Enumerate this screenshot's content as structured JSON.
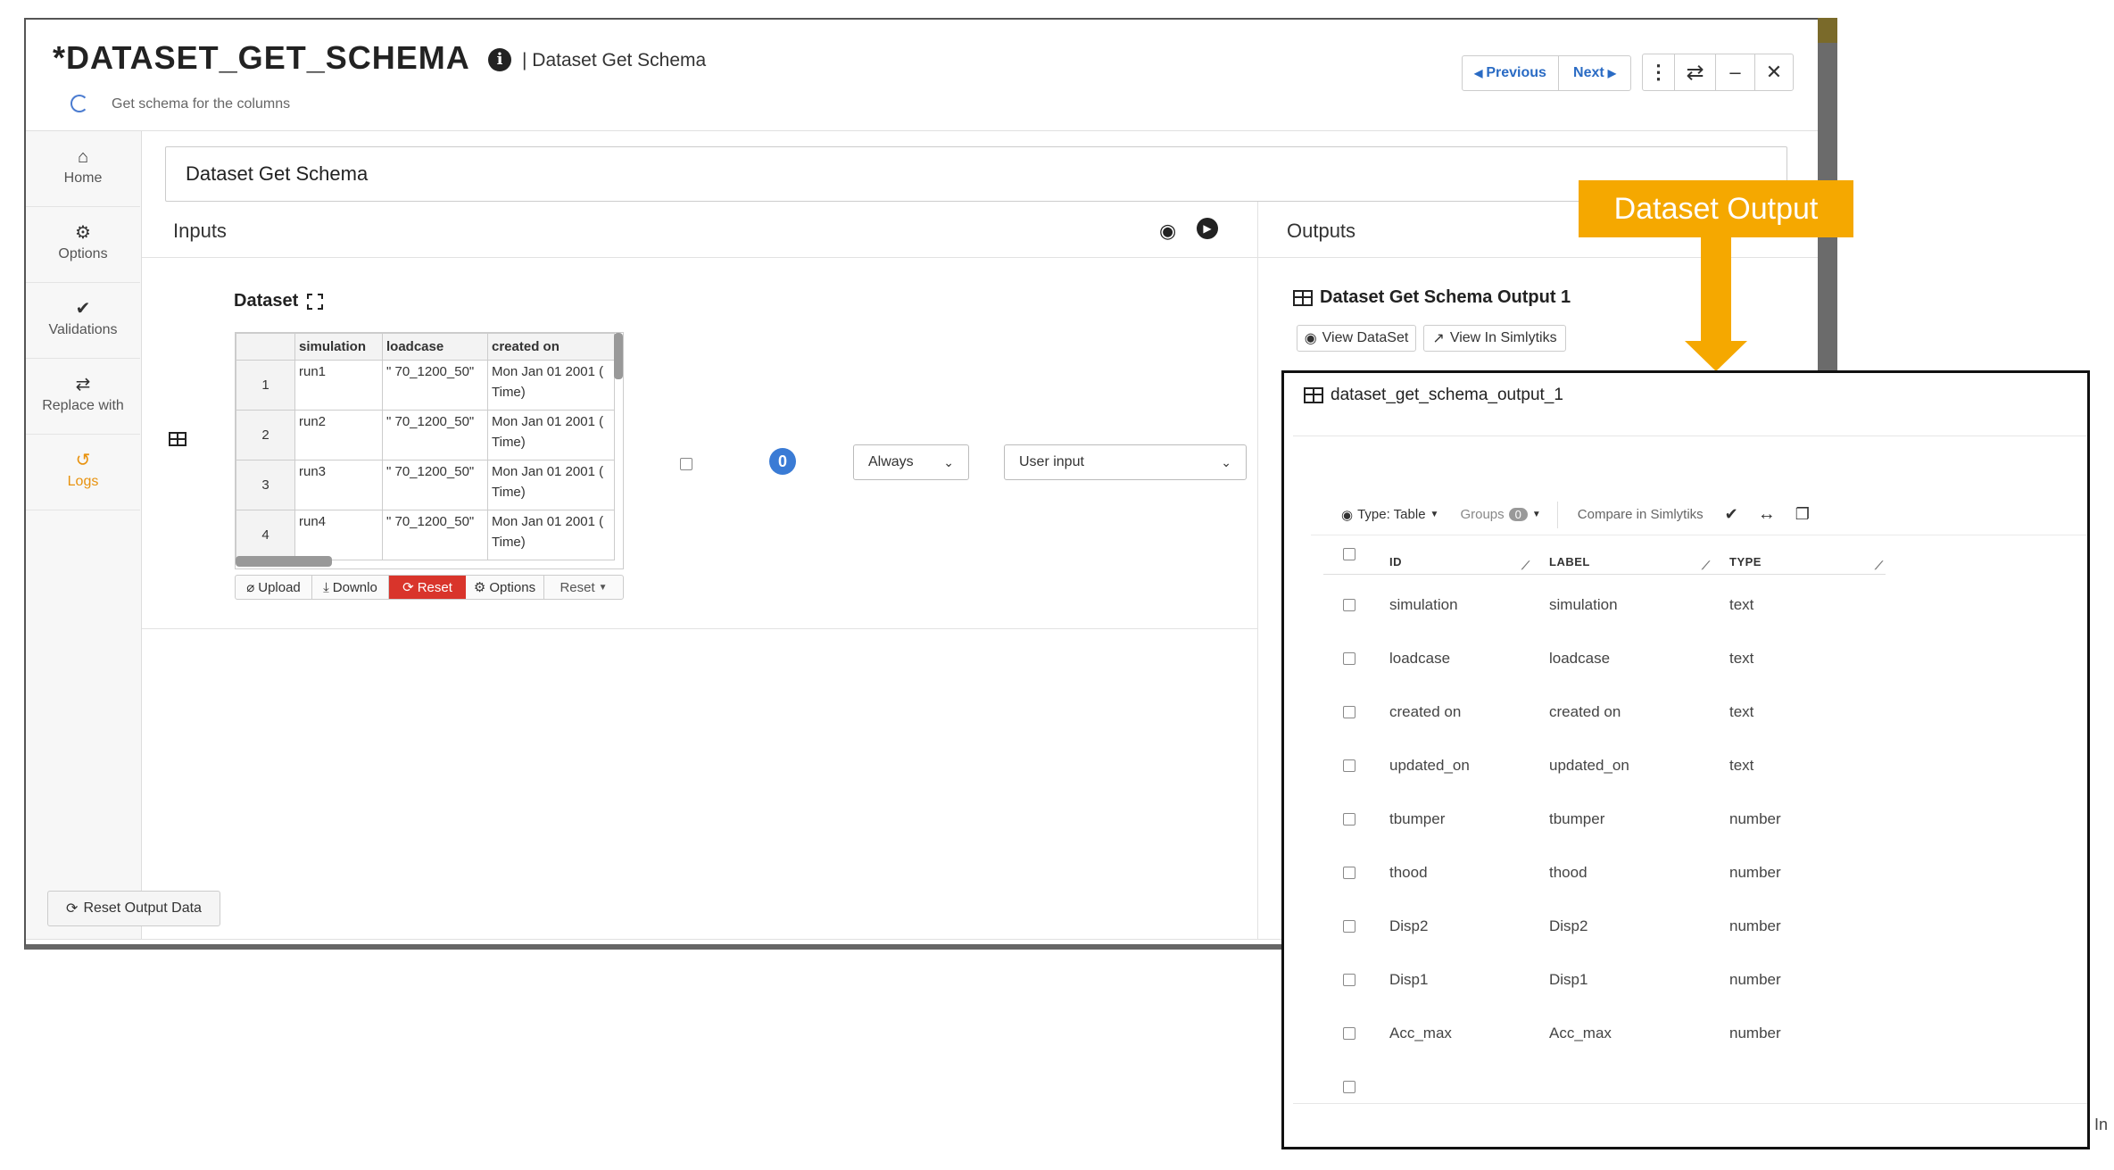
{
  "header": {
    "title": "*DATASET_GET_SCHEMA",
    "subtitle_sep": "| Dataset Get Schema",
    "description": "Get schema for the columns",
    "prev_label": "Previous",
    "next_label": "Next"
  },
  "sidebar": {
    "items": [
      {
        "label": "Home",
        "icon": "home-icon"
      },
      {
        "label": "Options",
        "icon": "gear-icon"
      },
      {
        "label": "Validations",
        "icon": "double-check-icon"
      },
      {
        "label": "Replace with",
        "icon": "swap-icon"
      },
      {
        "label": "Logs",
        "icon": "history-icon"
      }
    ]
  },
  "main": {
    "name_value": "Dataset Get Schema",
    "inputs_title": "Inputs",
    "outputs_title": "Outputs",
    "dataset_label": "Dataset",
    "badge_count": "0",
    "when_select": "Always",
    "source_select": "User input",
    "table": {
      "headers": [
        "simulation",
        "loadcase",
        "created on"
      ],
      "rows": [
        {
          "n": "1",
          "simulation": "run1",
          "loadcase": "\" 70_1200_50\"",
          "created": "Mon Jan 01 2001 (",
          "created2": "Time)"
        },
        {
          "n": "2",
          "simulation": "run2",
          "loadcase": "\" 70_1200_50\"",
          "created": "Mon Jan 01 2001 (",
          "created2": "Time)"
        },
        {
          "n": "3",
          "simulation": "run3",
          "loadcase": "\" 70_1200_50\"",
          "created": "Mon Jan 01 2001 (",
          "created2": "Time)"
        },
        {
          "n": "4",
          "simulation": "run4",
          "loadcase": "\" 70_1200_50\"",
          "created": "Mon Jan 01 2001 (",
          "created2": "Time)"
        }
      ],
      "buttons": {
        "upload": "Upload",
        "download": "Downlo",
        "reset": "Reset",
        "options": "Options",
        "reset_dd": "Reset"
      }
    },
    "output": {
      "title": "Dataset Get Schema Output 1",
      "view_dataset": "View DataSet",
      "view_simlytiks": "View In Simlytiks"
    },
    "reset_output": "Reset Output Data"
  },
  "callout": {
    "label": "Dataset Output",
    "color": "#f5a800"
  },
  "zoom_panel": {
    "title": "dataset_get_schema_output_1",
    "toolbar": {
      "type": "Type: Table",
      "groups": "Groups",
      "groups_count": "0",
      "compare": "Compare in Simlytiks"
    },
    "columns": [
      "ID",
      "LABEL",
      "TYPE"
    ],
    "rows": [
      {
        "id": "simulation",
        "label": "simulation",
        "type": "text"
      },
      {
        "id": "loadcase",
        "label": "loadcase",
        "type": "text"
      },
      {
        "id": "created on",
        "label": "created on",
        "type": "text"
      },
      {
        "id": "updated_on",
        "label": "updated_on",
        "type": "text"
      },
      {
        "id": "tbumper",
        "label": "tbumper",
        "type": "number"
      },
      {
        "id": "thood",
        "label": "thood",
        "type": "number"
      },
      {
        "id": "Disp2",
        "label": "Disp2",
        "type": "number"
      },
      {
        "id": "Disp1",
        "label": "Disp1",
        "type": "number"
      },
      {
        "id": "Acc_max",
        "label": "Acc_max",
        "type": "number"
      }
    ],
    "edge_text": "In"
  }
}
